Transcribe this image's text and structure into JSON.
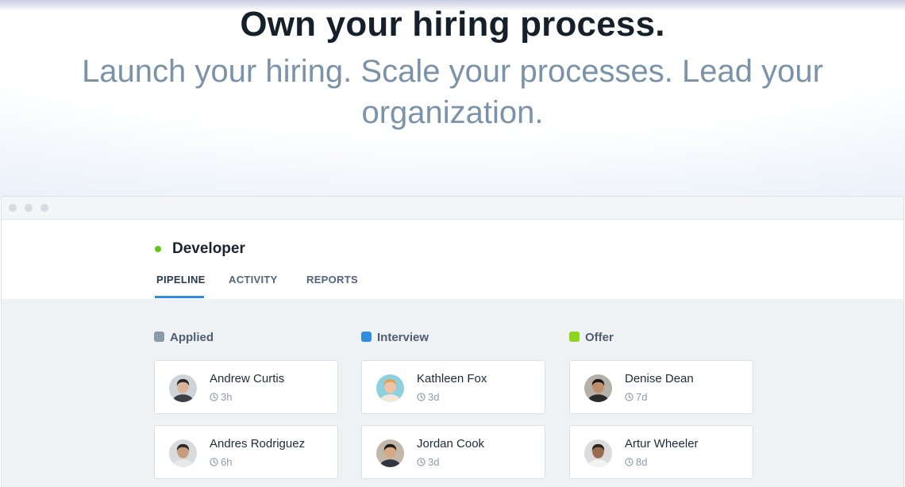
{
  "hero": {
    "headline": "Own your hiring process.",
    "subheadline": "Launch your hiring. Scale your processes. Lead your organization."
  },
  "window": {
    "job": {
      "title": "Developer",
      "status_color": "#5fc51a"
    },
    "tabs": [
      {
        "label": "PIPELINE",
        "active": true
      },
      {
        "label": "ACTIVITY",
        "active": false
      },
      {
        "label": "REPORTS",
        "active": false
      }
    ],
    "columns": [
      {
        "label": "Applied",
        "color": "#8a9ba9",
        "candidates": [
          {
            "name": "Andrew Curtis",
            "time": "3h",
            "avatar": "avatar-icon"
          },
          {
            "name": "Andres Rodriguez",
            "time": "6h",
            "avatar": "avatar-icon"
          }
        ]
      },
      {
        "label": "Interview",
        "color": "#2f8ee0",
        "candidates": [
          {
            "name": "Kathleen Fox",
            "time": "3d",
            "avatar": "avatar-icon"
          },
          {
            "name": "Jordan Cook",
            "time": "3d",
            "avatar": "avatar-icon"
          }
        ]
      },
      {
        "label": "Offer",
        "color": "#8ed61c",
        "candidates": [
          {
            "name": "Denise Dean",
            "time": "7d",
            "avatar": "avatar-icon"
          },
          {
            "name": "Artur Wheeler",
            "time": "8d",
            "avatar": "avatar-icon"
          }
        ]
      }
    ]
  }
}
